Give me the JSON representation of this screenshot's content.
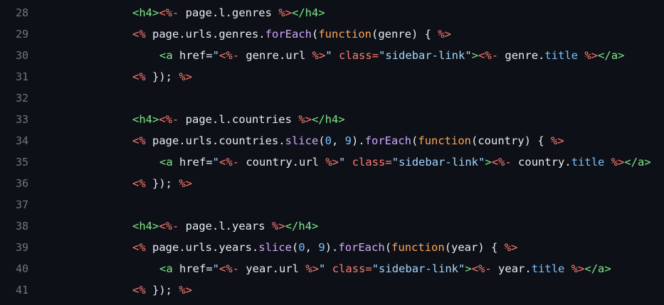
{
  "theme": {
    "background": "#0d1117",
    "line_number": "#6e7681",
    "text": "#e6edf3",
    "tag": "#7ee787",
    "erb_delimiter": "#ff7b72",
    "attribute": "#ff7b72",
    "string": "#a5d6ff",
    "function": "#d2a8ff",
    "property": "#79c0ff",
    "number": "#79c0ff",
    "keyword": "#ffa657"
  },
  "lines": [
    {
      "number": "28",
      "indent": 2,
      "tokens": [
        [
          "tag",
          "<h4>"
        ],
        [
          "erb",
          "<%-"
        ],
        [
          "txt",
          " page.l.genres "
        ],
        [
          "erb",
          "%>"
        ],
        [
          "tag",
          "</h4>"
        ]
      ]
    },
    {
      "number": "29",
      "indent": 2,
      "tokens": [
        [
          "erb",
          "<%"
        ],
        [
          "txt",
          " page.urls.genres."
        ],
        [
          "fn",
          "forEach"
        ],
        [
          "txt",
          "("
        ],
        [
          "kw",
          "function"
        ],
        [
          "txt",
          "(genre) { "
        ],
        [
          "erb",
          "%>"
        ]
      ]
    },
    {
      "number": "30",
      "indent": 3,
      "tokens": [
        [
          "tag",
          "<a"
        ],
        [
          "txt",
          " href="
        ],
        [
          "str",
          "\""
        ],
        [
          "erb",
          "<%-"
        ],
        [
          "txt",
          " genre.url "
        ],
        [
          "erb",
          "%>"
        ],
        [
          "str",
          "\""
        ],
        [
          "txt",
          " "
        ],
        [
          "attr",
          "class="
        ],
        [
          "str",
          "\"sidebar-link\""
        ],
        [
          "tag",
          ">"
        ],
        [
          "erb",
          "<%-"
        ],
        [
          "txt",
          " genre."
        ],
        [
          "prop",
          "title"
        ],
        [
          "txt",
          " "
        ],
        [
          "erb",
          "%>"
        ],
        [
          "tag",
          "</a>"
        ]
      ]
    },
    {
      "number": "31",
      "indent": 2,
      "tokens": [
        [
          "erb",
          "<%"
        ],
        [
          "txt",
          " }); "
        ],
        [
          "erb",
          "%>"
        ]
      ]
    },
    {
      "number": "32",
      "indent": 0,
      "tokens": []
    },
    {
      "number": "33",
      "indent": 2,
      "tokens": [
        [
          "tag",
          "<h4>"
        ],
        [
          "erb",
          "<%-"
        ],
        [
          "txt",
          " page.l.countries "
        ],
        [
          "erb",
          "%>"
        ],
        [
          "tag",
          "</h4>"
        ]
      ]
    },
    {
      "number": "34",
      "indent": 2,
      "tokens": [
        [
          "erb",
          "<%"
        ],
        [
          "txt",
          " page.urls.countries."
        ],
        [
          "fn",
          "slice"
        ],
        [
          "txt",
          "("
        ],
        [
          "num",
          "0"
        ],
        [
          "txt",
          ", "
        ],
        [
          "num",
          "9"
        ],
        [
          "txt",
          ")."
        ],
        [
          "fn",
          "forEach"
        ],
        [
          "txt",
          "("
        ],
        [
          "kw",
          "function"
        ],
        [
          "txt",
          "(country) { "
        ],
        [
          "erb",
          "%>"
        ]
      ]
    },
    {
      "number": "35",
      "indent": 3,
      "tokens": [
        [
          "tag",
          "<a"
        ],
        [
          "txt",
          " href="
        ],
        [
          "str",
          "\""
        ],
        [
          "erb",
          "<%-"
        ],
        [
          "txt",
          " country.url "
        ],
        [
          "erb",
          "%>"
        ],
        [
          "str",
          "\""
        ],
        [
          "txt",
          " "
        ],
        [
          "attr",
          "class="
        ],
        [
          "str",
          "\"sidebar-link\""
        ],
        [
          "tag",
          ">"
        ],
        [
          "erb",
          "<%-"
        ],
        [
          "txt",
          " country."
        ],
        [
          "prop",
          "title"
        ],
        [
          "txt",
          " "
        ],
        [
          "erb",
          "%>"
        ],
        [
          "tag",
          "</a>"
        ]
      ]
    },
    {
      "number": "36",
      "indent": 2,
      "tokens": [
        [
          "erb",
          "<%"
        ],
        [
          "txt",
          " }); "
        ],
        [
          "erb",
          "%>"
        ]
      ]
    },
    {
      "number": "37",
      "indent": 0,
      "tokens": []
    },
    {
      "number": "38",
      "indent": 2,
      "tokens": [
        [
          "tag",
          "<h4>"
        ],
        [
          "erb",
          "<%-"
        ],
        [
          "txt",
          " page.l.years "
        ],
        [
          "erb",
          "%>"
        ],
        [
          "tag",
          "</h4>"
        ]
      ]
    },
    {
      "number": "39",
      "indent": 2,
      "tokens": [
        [
          "erb",
          "<%"
        ],
        [
          "txt",
          " page.urls.years."
        ],
        [
          "fn",
          "slice"
        ],
        [
          "txt",
          "("
        ],
        [
          "num",
          "0"
        ],
        [
          "txt",
          ", "
        ],
        [
          "num",
          "9"
        ],
        [
          "txt",
          ")."
        ],
        [
          "fn",
          "forEach"
        ],
        [
          "txt",
          "("
        ],
        [
          "kw",
          "function"
        ],
        [
          "txt",
          "(year) { "
        ],
        [
          "erb",
          "%>"
        ]
      ]
    },
    {
      "number": "40",
      "indent": 3,
      "tokens": [
        [
          "tag",
          "<a"
        ],
        [
          "txt",
          " href="
        ],
        [
          "str",
          "\""
        ],
        [
          "erb",
          "<%-"
        ],
        [
          "txt",
          " year.url "
        ],
        [
          "erb",
          "%>"
        ],
        [
          "str",
          "\""
        ],
        [
          "txt",
          " "
        ],
        [
          "attr",
          "class="
        ],
        [
          "str",
          "\"sidebar-link\""
        ],
        [
          "tag",
          ">"
        ],
        [
          "erb",
          "<%-"
        ],
        [
          "txt",
          " year."
        ],
        [
          "prop",
          "title"
        ],
        [
          "txt",
          " "
        ],
        [
          "erb",
          "%>"
        ],
        [
          "tag",
          "</a>"
        ]
      ]
    },
    {
      "number": "41",
      "indent": 2,
      "tokens": [
        [
          "erb",
          "<%"
        ],
        [
          "txt",
          " }); "
        ],
        [
          "erb",
          "%>"
        ]
      ]
    }
  ]
}
